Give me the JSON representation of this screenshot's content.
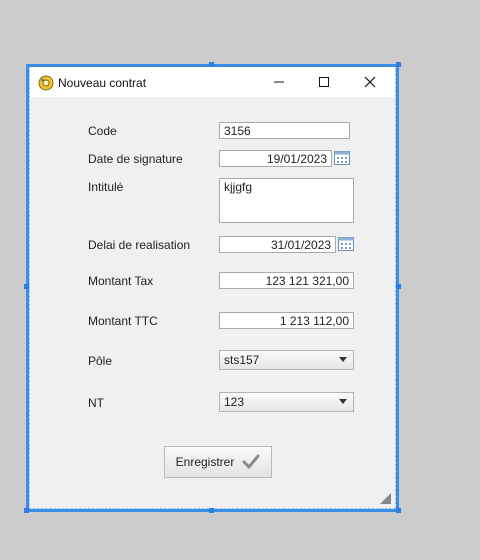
{
  "window": {
    "title": "Nouveau contrat",
    "icons": {
      "app": "gear-icon",
      "minimize": "minimize-icon",
      "maximize": "maximize-icon",
      "close": "close-icon"
    }
  },
  "form": {
    "code_label": "Code",
    "code_value": "3156",
    "date_signature_label": "Date de signature",
    "date_signature_value": "19/01/2023",
    "intitule_label": "Intitulé",
    "intitule_value": "kjjgfg",
    "delai_label": "Delai de realisation",
    "delai_value": "31/01/2023",
    "montant_tax_label": "Montant Tax",
    "montant_tax_value": "123 121 321,00",
    "montant_ttc_label": "Montant TTC",
    "montant_ttc_value": "1 213 112,00",
    "pole_label": "Pôle",
    "pole_value": "sts157",
    "nt_label": "NT",
    "nt_value": "123"
  },
  "actions": {
    "save_label": "Enregistrer",
    "save_icon": "checkmark-icon"
  },
  "colors": {
    "selection_border": "#3a8ee6",
    "window_bg": "#f0f0f0",
    "titlebar_bg": "#ffffff"
  }
}
